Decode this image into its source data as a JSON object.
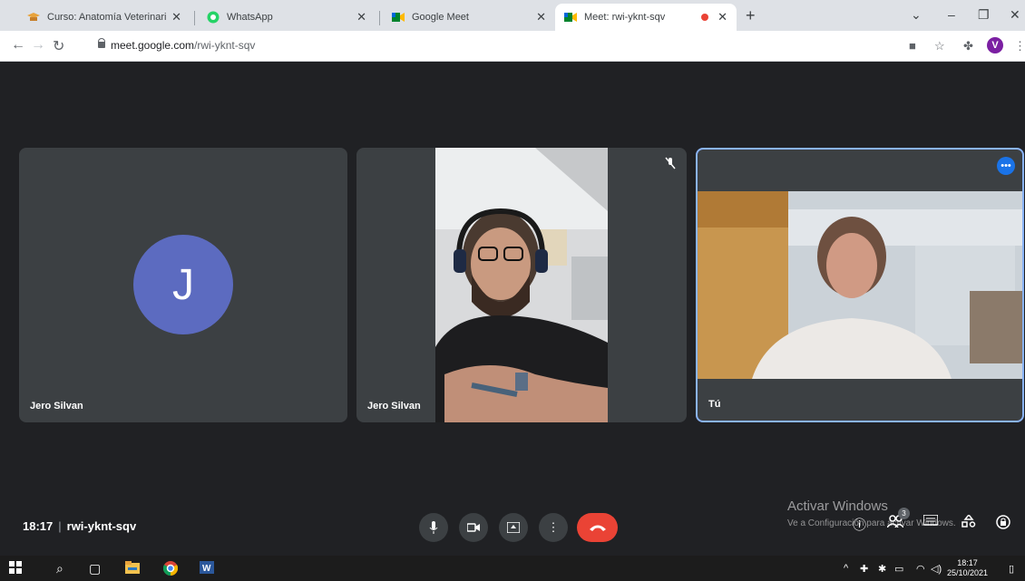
{
  "browser": {
    "tabs": [
      {
        "label": "Curso: Anatomía Veterinaria II, Tr",
        "icon": "graduation-cap-icon",
        "close": "✕"
      },
      {
        "label": "WhatsApp",
        "icon": "whatsapp-icon",
        "close": "✕"
      },
      {
        "label": "Google Meet",
        "icon": "google-meet-icon",
        "close": "✕"
      },
      {
        "label": "Meet: rwi-yknt-sqv",
        "icon": "google-meet-icon",
        "close": "✕"
      }
    ],
    "new_tab": "+",
    "window_controls": {
      "minimize": "–",
      "restore": "❐",
      "close": "✕",
      "menu": "⌄"
    },
    "address": {
      "host": "meet.google.com",
      "path": "/rwi-yknt-sqv"
    },
    "profile_initial": "V"
  },
  "meet": {
    "tiles": [
      {
        "name": "Jero Silvan",
        "initial": "J"
      },
      {
        "name": "Jero Silvan"
      },
      {
        "name": "Tú"
      }
    ],
    "time": "18:17",
    "meeting_code": "rwi-yknt-sqv",
    "participant_count": "3",
    "colors": {
      "stage": "#202124",
      "tile": "#3c4043",
      "accent": "#1a73e8",
      "end_call": "#ea4335"
    }
  },
  "windows": {
    "activate_title": "Activar Windows",
    "activate_sub": "Ve a Configuración para activar Windows.",
    "clock_time": "18:17",
    "clock_date": "25/10/2021"
  }
}
